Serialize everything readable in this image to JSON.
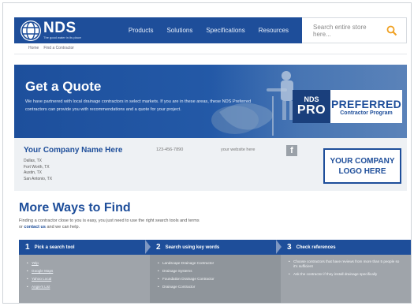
{
  "header": {
    "logo_name": "NDS",
    "logo_tagline": "The good water in its place",
    "nav": [
      "Products",
      "Solutions",
      "Specifications",
      "Resources"
    ],
    "search_placeholder": "Search entire store here..."
  },
  "breadcrumb": [
    "Home",
    "Find a Contractor"
  ],
  "hero": {
    "title": "Get a Quote",
    "text": "We have partnered with local drainage contractors in select markets. If you are in these areas, these NDS Preferred contractors can provide you with recommendations and a quote for your project.",
    "badge_nds": "NDS",
    "badge_pro": "PRO",
    "badge_preferred": "PREFERRED",
    "badge_program": "Contractor Program"
  },
  "company": {
    "name": "Your Company Name Here",
    "cities": [
      "Dallas, TX",
      "Fort Worth, TX",
      "Austin, TX",
      "San Antonio, TX"
    ],
    "phone": "123-456-7890",
    "website": "your website here",
    "facebook_glyph": "f",
    "logo_line1": "YOUR COMPANY",
    "logo_line2": "LOGO HERE"
  },
  "more": {
    "title": "More Ways to Find",
    "text_before": "Finding a contractor close to you is easy, you just need to use the right search tools and terms or ",
    "text_link": "contact us",
    "text_after": " and we can help."
  },
  "steps": [
    {
      "num": "1",
      "title": "Pick a search tool",
      "items": [
        "Yelp",
        "Google Maps",
        "Yahoo Local",
        "Angie's List"
      ]
    },
    {
      "num": "2",
      "title": "Search using key words",
      "items": [
        "Landscape Drainage Contractor",
        "Drainage Systems",
        "Foundation Drainage Contractor",
        "Drainage Contractor"
      ]
    },
    {
      "num": "3",
      "title": "Check references",
      "items": [
        "Choose contractors that have reviews from more than 5 people so it's sufficient",
        "Ask the contractor if they install drainage specifically"
      ]
    }
  ],
  "colors": {
    "brand_blue": "#1e4e9a",
    "step_gray": "#9fa4aa",
    "company_bg": "#eef1f4"
  }
}
